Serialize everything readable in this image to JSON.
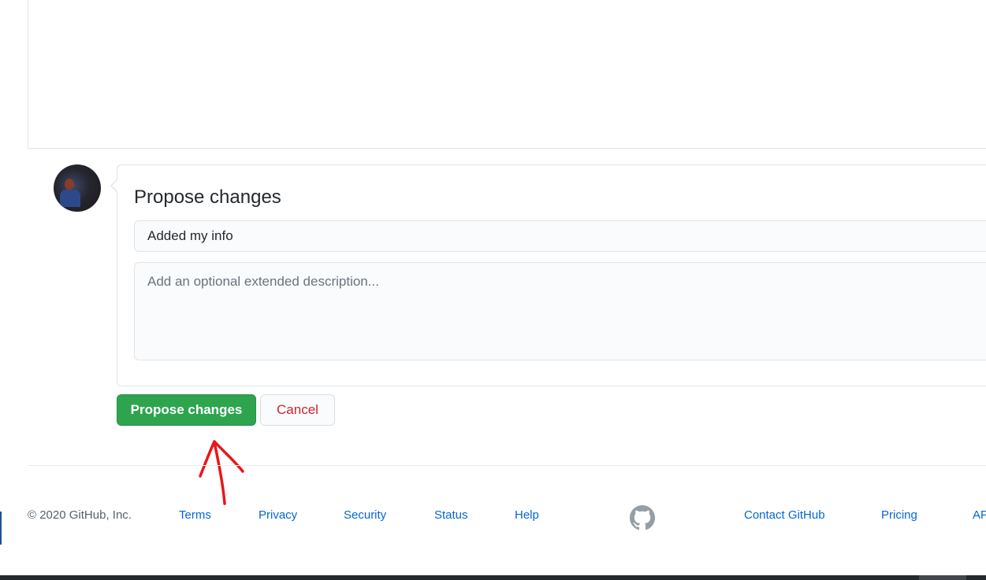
{
  "commit_form": {
    "title": "Propose changes",
    "summary_value": "Added my info",
    "description_placeholder": "Add an optional extended description..."
  },
  "buttons": {
    "propose_label": "Propose changes",
    "cancel_label": "Cancel"
  },
  "footer": {
    "copyright": "© 2020 GitHub, Inc.",
    "links_left": [
      "Terms",
      "Privacy",
      "Security",
      "Status",
      "Help"
    ],
    "links_right": [
      "Contact GitHub",
      "Pricing",
      "API"
    ]
  },
  "icons": {
    "footer_logo": "github-mark-icon",
    "annotation": "red-arrow-icon"
  },
  "colors": {
    "primary_button": "#2ea44f",
    "cancel_text": "#cb2431",
    "link": "#0366d6",
    "annotation": "#e8161b"
  }
}
